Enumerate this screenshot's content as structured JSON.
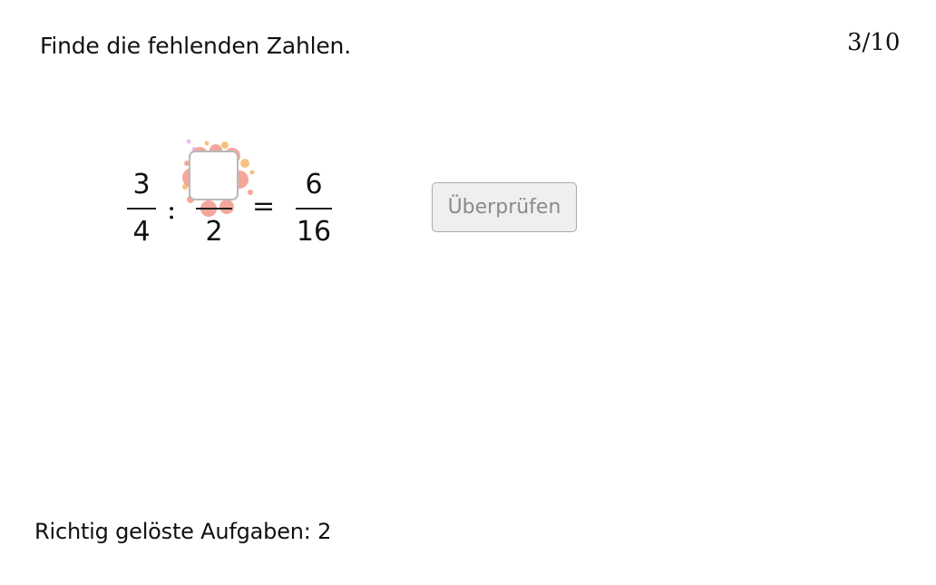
{
  "task": {
    "instruction": "Finde die fehlenden Zahlen.",
    "progress": "3/10"
  },
  "equation": {
    "left_fraction": {
      "numerator": "3",
      "denominator": "4"
    },
    "operator": ":",
    "missing_fraction": {
      "numerator": "",
      "denominator": "2"
    },
    "equals": "=",
    "result_fraction": {
      "numerator": "6",
      "denominator": "16"
    }
  },
  "check_button": {
    "label": "Überprüfen"
  },
  "score": {
    "text": "Richtig gelöste Aufgaben: 2"
  },
  "colors": {
    "splat": "#f08a7a",
    "splat_accent": "#f5b25c",
    "button_bg": "#efefef",
    "button_text": "#8a8a8a"
  }
}
